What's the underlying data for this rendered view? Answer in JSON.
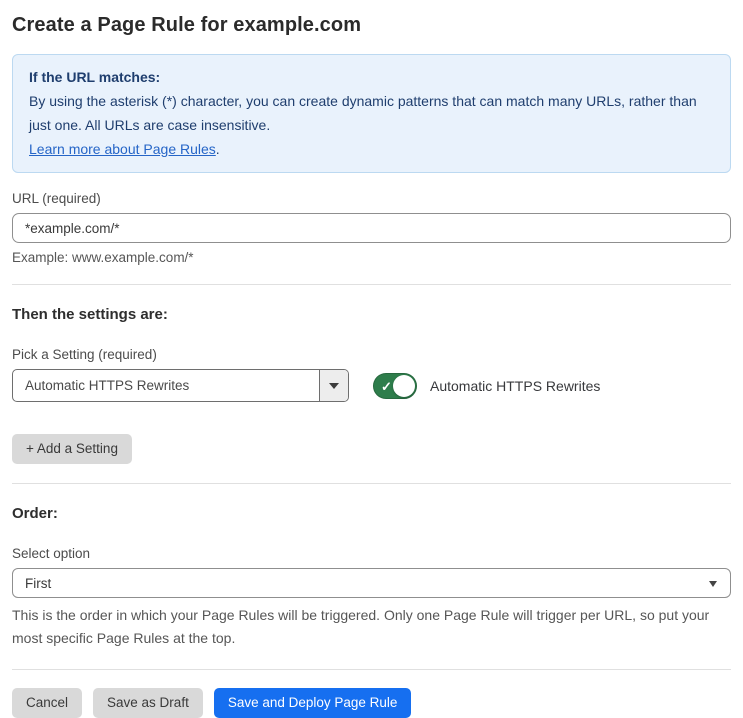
{
  "page": {
    "title": "Create a Page Rule for example.com"
  },
  "info_box": {
    "heading": "If the URL matches:",
    "body": "By using the asterisk (*) character, you can create dynamic patterns that can match many URLs, rather than just one. All URLs are case insensitive.",
    "link": "Learn more about Page Rules",
    "link_suffix": "."
  },
  "url_field": {
    "label": "URL (required)",
    "value": "*example.com/*",
    "example": "Example: www.example.com/*"
  },
  "settings": {
    "heading": "Then the settings are:",
    "pick_label": "Pick a Setting (required)",
    "selected_setting": "Automatic HTTPS Rewrites",
    "toggle_label": "Automatic HTTPS Rewrites",
    "toggle_state": "on",
    "toggle_check": "✓",
    "add_button": "+ Add a Setting"
  },
  "order": {
    "heading": "Order:",
    "select_label": "Select option",
    "selected_option": "First",
    "help": "This is the order in which your Page Rules will be triggered. Only one Page Rule will trigger per URL, so put your most specific Page Rules at the top."
  },
  "actions": {
    "cancel": "Cancel",
    "save_draft": "Save as Draft",
    "save_deploy": "Save and Deploy Page Rule"
  },
  "colors": {
    "info_bg": "#e9f2fc",
    "info_border": "#bcd9f1",
    "info_text": "#1f3e6e",
    "link_blue": "#2565c7",
    "toggle_green": "#2e7d4b",
    "primary_blue": "#166ff0",
    "button_gray": "#d9d9d9"
  }
}
